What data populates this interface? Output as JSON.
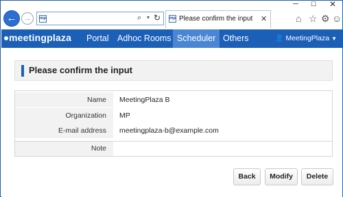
{
  "browser": {
    "address_favicon": "mp",
    "tab_favicon": "mp",
    "tab_title": "Please confirm the input",
    "window_controls": {
      "minimize": "─",
      "maximize": "☐",
      "close": "✕"
    },
    "icons": {
      "back": "back-arrow-icon",
      "forward": "forward-arrow-icon",
      "search": "search-icon",
      "reload": "reload-icon",
      "tab_close": "close-icon",
      "home": "home-icon",
      "favorites": "star-icon",
      "settings": "gear-icon",
      "feedback": "smiley-icon"
    }
  },
  "app": {
    "logo": "meetingplaza",
    "nav": {
      "portal": "Portal",
      "adhoc": "Adhoc Rooms",
      "scheduler": "Scheduler",
      "others": "Others"
    },
    "user": "MeetingPlaza",
    "accent_color": "#1b5fb7",
    "active_tab_color": "#4a86d4"
  },
  "page": {
    "heading": "Please confirm the input",
    "fields": {
      "name_label": "Name",
      "name_value": "MeetingPlaza B",
      "org_label": "Organization",
      "org_value": "MP",
      "email_label": "E-mail address",
      "email_value": "meetingplaza-b@example.com",
      "note_label": "Note",
      "note_value": ""
    },
    "buttons": {
      "back": "Back",
      "modify": "Modify",
      "delete": "Delete"
    }
  }
}
